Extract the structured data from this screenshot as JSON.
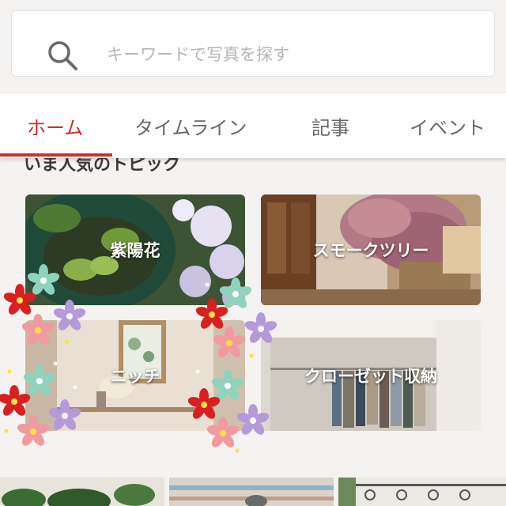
{
  "search": {
    "placeholder": "キーワードで写真を探す"
  },
  "tabs": [
    {
      "label": "ホーム",
      "active": true
    },
    {
      "label": "タイムライン",
      "active": false
    },
    {
      "label": "記事",
      "active": false
    },
    {
      "label": "イベント",
      "active": false
    }
  ],
  "section": {
    "title": "いま人気のトピック"
  },
  "topics": [
    {
      "label": "紫陽花"
    },
    {
      "label": "スモークツリー"
    },
    {
      "label": "ニッチ"
    },
    {
      "label": "クローゼット収納"
    }
  ],
  "colors": {
    "accent": "#c9302c",
    "background": "#f5f3f1",
    "tab_text": "#6b6866"
  }
}
